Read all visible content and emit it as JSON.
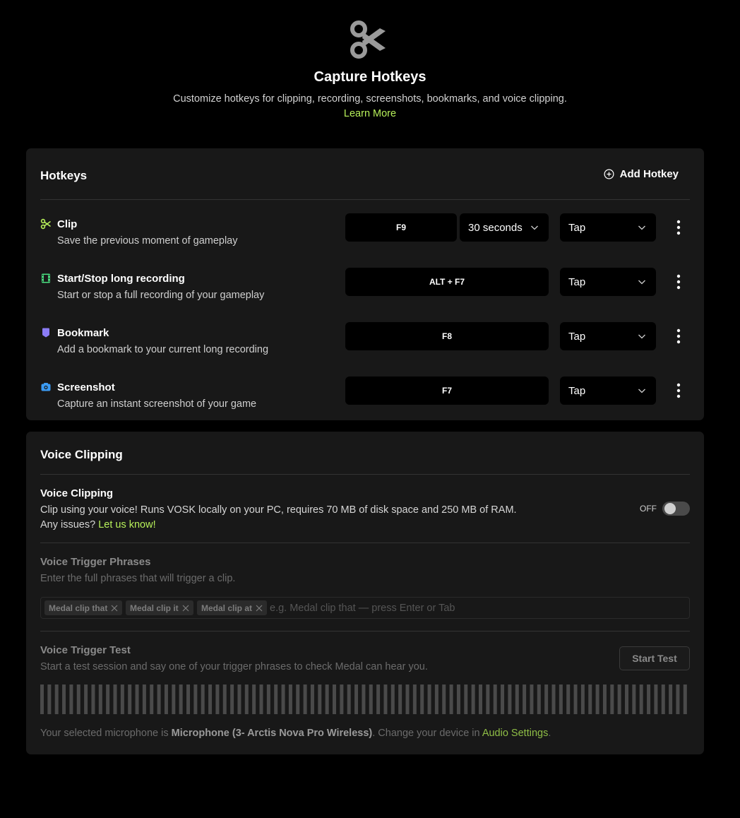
{
  "header": {
    "title": "Capture Hotkeys",
    "subtitle": "Customize hotkeys for clipping, recording, screenshots, bookmarks, and voice clipping.",
    "learn_more": "Learn More",
    "logo_icon": "scissors-icon"
  },
  "hotkeys": {
    "title": "Hotkeys",
    "add_label": "Add Hotkey",
    "rows": [
      {
        "title": "Clip",
        "description": "Save the previous moment of gameplay",
        "key": "F9",
        "duration": "30 seconds",
        "mode": "Tap",
        "icon": "scissors-icon",
        "color": "#b7f05a"
      },
      {
        "title": "Start/Stop long recording",
        "description": "Start or stop a full recording of your gameplay",
        "key": "ALT + F7",
        "mode": "Tap",
        "icon": "film-icon",
        "color": "#4ade80"
      },
      {
        "title": "Bookmark",
        "description": "Add a bookmark to your current long recording",
        "key": "F8",
        "mode": "Tap",
        "icon": "bookmark-icon",
        "color": "#8b7cf6"
      },
      {
        "title": "Screenshot",
        "description": "Capture an instant screenshot of your game",
        "key": "F7",
        "mode": "Tap",
        "icon": "camera-icon",
        "color": "#3b9cf5"
      }
    ]
  },
  "voice": {
    "title": "Voice Clipping",
    "section_title": "Voice Clipping",
    "description": "Clip using your voice! Runs VOSK locally on your PC, requires 70 MB of disk space and 250 MB of RAM.",
    "issues_prefix": "Any issues?",
    "issues_link": "Let us know!",
    "toggle_label": "OFF",
    "toggle_on": false,
    "phrases_title": "Voice Trigger Phrases",
    "phrases_desc": "Enter the full phrases that will trigger a clip.",
    "phrases": [
      "Medal clip that",
      "Medal clip it",
      "Medal clip at"
    ],
    "phrase_placeholder": "e.g. Medal clip that — press Enter or Tab",
    "test_title": "Voice Trigger Test",
    "test_desc": "Start a test session and say one of your trigger phrases to check Medal can hear you.",
    "start_test": "Start Test",
    "mic_prefix": "Your selected microphone is",
    "mic_name": "Microphone (3- Arctis Nova Pro Wireless)",
    "mic_mid": ". Change your device in",
    "mic_link": "Audio Settings",
    "mic_end": "."
  }
}
